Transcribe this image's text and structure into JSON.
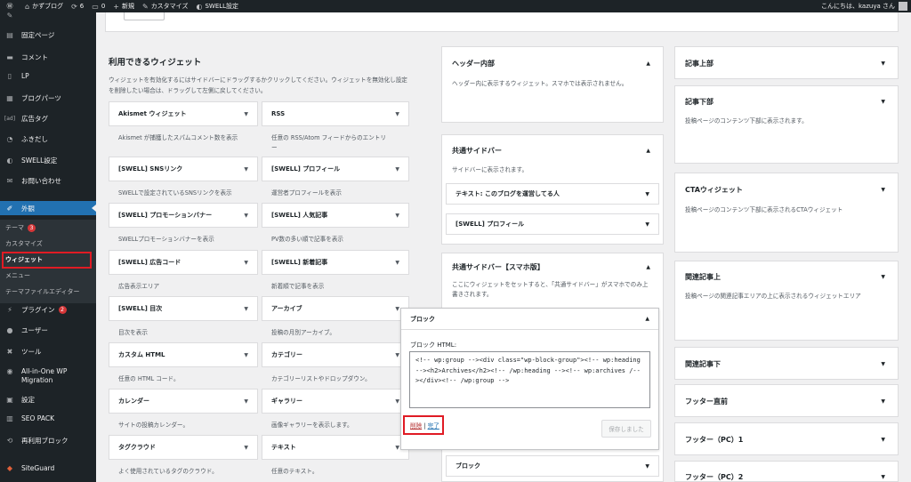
{
  "adminbar": {
    "site_name": "かずブログ",
    "updates": "6",
    "comments": "0",
    "new": "新規",
    "customize": "カスタマイズ",
    "swell": "SWELL設定",
    "greeting": "こんにちは、kazuya さん"
  },
  "sidebar": {
    "items": [
      {
        "label": "固定ページ"
      },
      {
        "label": "コメント"
      },
      {
        "label": "LP"
      },
      {
        "label": "ブログパーツ"
      },
      {
        "label": "広告タグ"
      },
      {
        "label": "ふきだし"
      },
      {
        "label": "SWELL設定"
      },
      {
        "label": "お問い合わせ"
      },
      {
        "label": "外観"
      },
      {
        "label": "プラグイン",
        "badge": "2"
      },
      {
        "label": "ユーザー"
      },
      {
        "label": "ツール"
      },
      {
        "label": "All-in-One WP Migration"
      },
      {
        "label": "設定"
      },
      {
        "label": "SEO PACK"
      },
      {
        "label": "再利用ブロック"
      },
      {
        "label": "SiteGuard"
      }
    ],
    "ad_icon": "[ad]",
    "submenu": [
      {
        "label": "テーマ",
        "badge": "3"
      },
      {
        "label": "カスタマイズ"
      },
      {
        "label": "ウィジェット"
      },
      {
        "label": "メニュー"
      },
      {
        "label": "テーマファイルエディター"
      }
    ]
  },
  "available": {
    "title": "利用できるウィジェット",
    "desc": "ウィジェットを有効化するにはサイドバーにドラッグするかクリックしてください。ウィジェットを無効化し設定を削除したい場合は、ドラッグして左側に戻してください。"
  },
  "widgets": [
    {
      "label": "Akismet ウィジェット",
      "desc": "Akismet が捕獲したスパムコメント数を表示"
    },
    {
      "label": "RSS",
      "desc": "任意の RSS/Atom フィードからのエントリ",
      "desc2": "ー"
    },
    {
      "label": "[SWELL] SNSリンク",
      "desc": "SWELLで設定されているSNSリンクを表示"
    },
    {
      "label": "[SWELL] プロフィール",
      "desc": "運営者プロフィールを表示"
    },
    {
      "label": "[SWELL] プロモーションバナー",
      "desc": "SWELLプロモーションバナーを表示"
    },
    {
      "label": "[SWELL] 人気記事",
      "desc": "PV数の多い順で記事を表示"
    },
    {
      "label": "[SWELL] 広告コード",
      "desc": "広告表示エリア"
    },
    {
      "label": "[SWELL] 新着記事",
      "desc": "新着順で記事を表示"
    },
    {
      "label": "[SWELL] 目次",
      "desc": "目次を表示"
    },
    {
      "label": "アーカイブ",
      "desc": "投稿の月別アーカイブ。"
    },
    {
      "label": "カスタム HTML",
      "desc": "任意の HTML コード。"
    },
    {
      "label": "カテゴリー",
      "desc": "カテゴリーリストやドロップダウン。"
    },
    {
      "label": "カレンダー",
      "desc": "サイトの投稿カレンダー。"
    },
    {
      "label": "ギャラリー",
      "desc": "画像ギャラリーを表示します。"
    },
    {
      "label": "タグクラウド",
      "desc": "よく使用されているタグのクラウド。"
    },
    {
      "label": "テキスト",
      "desc": "任意のテキスト。"
    }
  ],
  "areas": {
    "header": {
      "title": "ヘッダー内部",
      "desc": "ヘッダー内に表示するウィジェット。スマホでは表示されません。"
    },
    "common": {
      "title": "共通サイドバー",
      "desc": "サイドバーに表示されます。",
      "w1": "テキスト: このブログを運営してる人",
      "w2": "[SWELL] プロフィール"
    },
    "mobile": {
      "title": "共通サイドバー【スマホ版】",
      "desc": "ここにウィジェットをセットすると、「共通サイドバー」がスマホでのみ上書きされます。"
    },
    "block2": "ブロック",
    "right": [
      {
        "title": "記事上部"
      },
      {
        "title": "記事下部",
        "desc": "投稿ページのコンテンツ下部に表示されます。"
      },
      {
        "title": "CTAウィジェット",
        "desc": "投稿ページのコンテンツ下部に表示されるCTAウィジェット"
      },
      {
        "title": "関連記事上",
        "desc": "投稿ページの関連記事エリアの上に表示されるウィジェットエリア"
      },
      {
        "title": "関連記事下"
      },
      {
        "title": "フッター直前"
      },
      {
        "title": "フッター（PC）1"
      },
      {
        "title": "フッター（PC）2"
      }
    ]
  },
  "block_editor": {
    "title": "ブロック",
    "label": "ブロック HTML:",
    "code": "<!-- wp:group --><div class=\"wp-block-group\"><!-- wp:heading --><h2>Archives</h2><!-- /wp:heading --><!-- wp:archives /--></div><!-- /wp:group -->",
    "delete": "削除",
    "sep": " | ",
    "done": "完了",
    "save": "保存しました"
  },
  "icons": {
    "arrow": "▼",
    "arrow_up": "▲"
  },
  "colors": {
    "admin_dark": "#1d2327",
    "accent": "#2271b1",
    "highlight": "#e01b24",
    "badge": "#d63638"
  }
}
